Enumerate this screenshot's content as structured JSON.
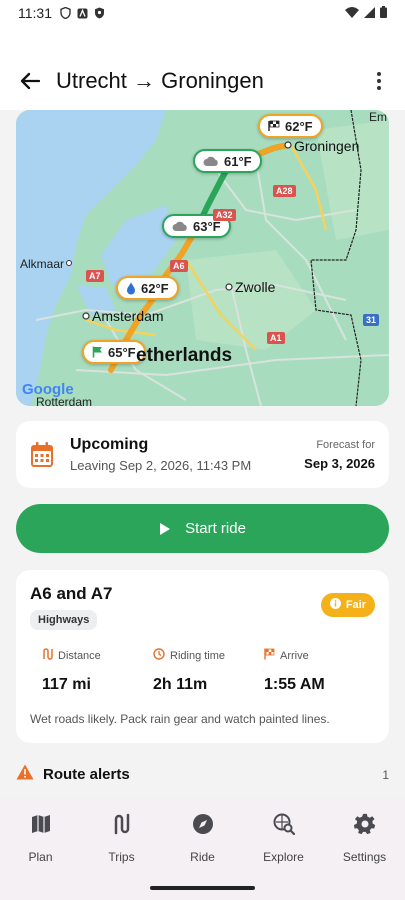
{
  "status_bar": {
    "time": "11:31"
  },
  "app_bar": {
    "title": "Utrecht → Groningen"
  },
  "map": {
    "pins": [
      {
        "temp": "62°F",
        "icon": "finish-flag-icon",
        "style": "orange"
      },
      {
        "temp": "61°F",
        "icon": "cloud-icon",
        "style": "green"
      },
      {
        "temp": "63°F",
        "icon": "cloud-icon",
        "style": "green"
      },
      {
        "temp": "62°F",
        "icon": "rain-drop-icon",
        "style": "orange"
      },
      {
        "temp": "65°F",
        "icon": "start-flag-icon",
        "style": "orange"
      }
    ],
    "labels": {
      "groningen": "Groningen",
      "alkmaar": "Alkmaar",
      "zwolle": "Zwolle",
      "amsterdam": "Amsterdam",
      "netherlands": "etherlands",
      "rotterdam": "Rotterdam",
      "emmen": "Em"
    },
    "shields": {
      "a28": "A28",
      "a32": "A32",
      "a6": "A6",
      "a7": "A7",
      "a1": "A1",
      "n31": "31"
    },
    "attribution": "Google"
  },
  "upcoming": {
    "title": "Upcoming",
    "subtitle": "Leaving Sep 2, 2026, 11:43 PM",
    "forecast_label": "Forecast for",
    "forecast_date": "Sep 3, 2026"
  },
  "start_button": {
    "label": "Start ride"
  },
  "route": {
    "name": "A6 and A7",
    "chip": "Highways",
    "badge": "Fair",
    "stats": [
      {
        "label": "Distance",
        "value": "117 mi",
        "icon": "distance-icon"
      },
      {
        "label": "Riding time",
        "value": "2h 11m",
        "icon": "clock-icon"
      },
      {
        "label": "Arrive",
        "value": "1:55 AM",
        "icon": "finish-flag-icon"
      }
    ],
    "note": "Wet roads likely. Pack rain gear and watch painted lines."
  },
  "alerts": {
    "title": "Route alerts",
    "count": "1"
  },
  "nav": [
    {
      "label": "Plan",
      "icon": "map-icon"
    },
    {
      "label": "Trips",
      "icon": "route-icon"
    },
    {
      "label": "Ride",
      "icon": "compass-icon"
    },
    {
      "label": "Explore",
      "icon": "explore-icon"
    },
    {
      "label": "Settings",
      "icon": "gear-icon"
    }
  ],
  "colors": {
    "accent_green": "#2aa55a",
    "accent_orange": "#f0a324",
    "badge_fair": "#f4b11a",
    "alert": "#e8702a"
  }
}
